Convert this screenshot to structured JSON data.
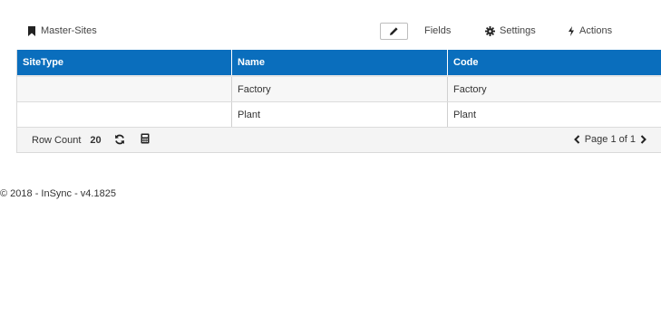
{
  "toolbar": {
    "title": "Master-Sites",
    "fields_label": "Fields",
    "settings_label": "Settings",
    "actions_label": "Actions"
  },
  "grid": {
    "columns": [
      "SiteType",
      "Name",
      "Code"
    ],
    "rows": [
      [
        "",
        "Factory",
        "Factory"
      ],
      [
        "",
        "Plant",
        "Plant"
      ]
    ],
    "footer": {
      "row_count_label": "Row Count",
      "row_count_value": "20",
      "page_label": "Page 1 of 1"
    }
  },
  "copyright": "© 2018 - InSync - v4.1825",
  "colors": {
    "header_bg": "#0a6ebd",
    "header_text": "#ffffff"
  }
}
